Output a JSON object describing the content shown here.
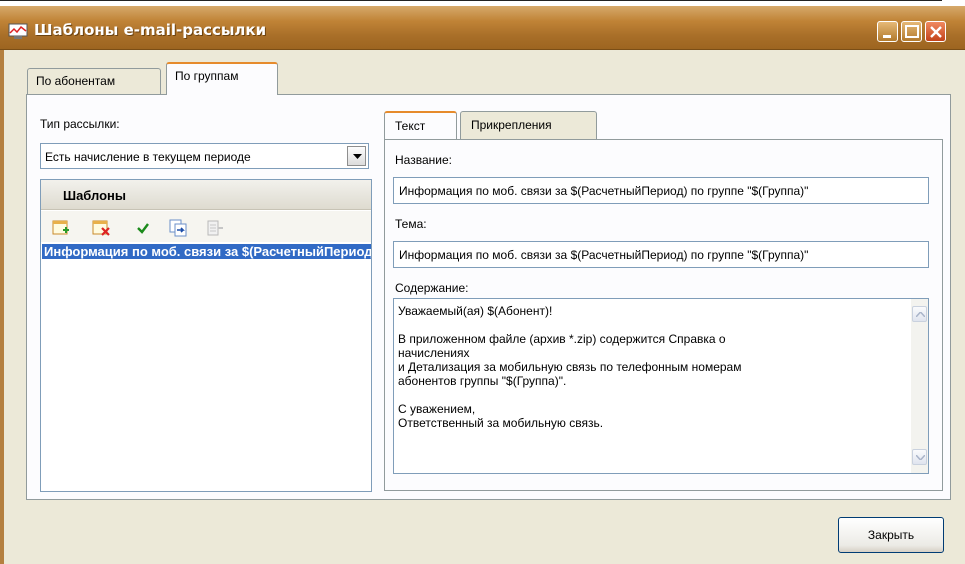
{
  "window": {
    "title": "Шаблоны e-mail-рассылки"
  },
  "outer_tabs": [
    {
      "label": "По абонентам"
    },
    {
      "label": "По группам"
    }
  ],
  "type": {
    "label": "Тип рассылки:",
    "value": "Есть начисление в текущем периоде"
  },
  "templates": {
    "header": "Шаблоны",
    "toolbar_icons": [
      "add-template-icon",
      "delete-template-icon",
      "check-icon",
      "copy-template-icon",
      "disabled-action-icon"
    ],
    "selected_item": "Информация по моб. связи за $(РасчетныйПериод) по группе \"$(Группа)\""
  },
  "inner_tabs": [
    {
      "label": "Текст"
    },
    {
      "label": "Прикрепления"
    }
  ],
  "form": {
    "name_label": "Название:",
    "name_value": "Информация по моб. связи за $(РасчетныйПериод) по группе \"$(Группа)\"",
    "subject_label": "Тема:",
    "subject_value": "Информация по моб. связи за $(РасчетныйПериод) по группе \"$(Группа)\"",
    "content_label": "Содержание:",
    "content_lines": [
      "Уважаемый(ая) $(Абонент)!",
      "",
      "В приложенном файле (архив *.zip) содержится Справка о",
      "начислениях",
      "и Детализация за мобильную связь по телефонным номерам",
      "абонентов группы \"$(Группа)\".",
      "",
      "С уважением,",
      "Ответственный за мобильную связь."
    ]
  },
  "buttons": {
    "close": "Закрыть"
  },
  "colors": {
    "titlebar": "#c08336",
    "selection": "#316ac5",
    "active_tab_accent": "#e68b2c"
  }
}
